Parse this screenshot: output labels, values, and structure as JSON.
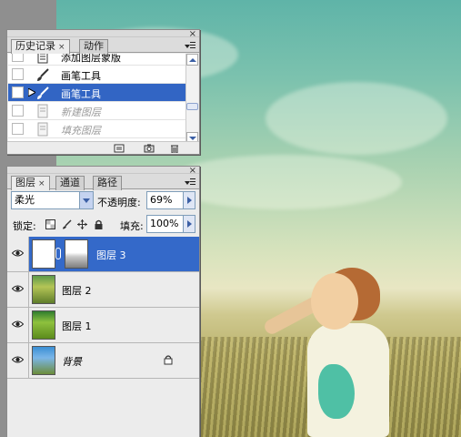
{
  "history_panel": {
    "tabs": [
      {
        "label": "历史记录",
        "active": true
      },
      {
        "label": "动作",
        "active": false
      }
    ],
    "items": [
      {
        "label": "添加图层蒙版",
        "state": "normal"
      },
      {
        "label": "画笔工具",
        "state": "normal"
      },
      {
        "label": "画笔工具",
        "state": "selected"
      },
      {
        "label": "新建图层",
        "state": "dimmed"
      },
      {
        "label": "填充图层",
        "state": "dimmed"
      }
    ]
  },
  "layers_panel": {
    "tabs": [
      {
        "label": "图层",
        "active": true
      },
      {
        "label": "通道",
        "active": false
      },
      {
        "label": "路径",
        "active": false
      }
    ],
    "blend_mode": "柔光",
    "opacity_label": "不透明度:",
    "opacity_value": "69%",
    "lock_label": "锁定:",
    "fill_label": "填充:",
    "fill_value": "100%",
    "layers": [
      {
        "name": "图层 3",
        "selected": true,
        "has_mask": true
      },
      {
        "name": "图层 2",
        "selected": false
      },
      {
        "name": "图层 1",
        "selected": false
      },
      {
        "name": "背景",
        "selected": false,
        "locked": true
      }
    ]
  },
  "colors": {
    "selection": "#3265c4",
    "panel_bg": "#ececec"
  }
}
